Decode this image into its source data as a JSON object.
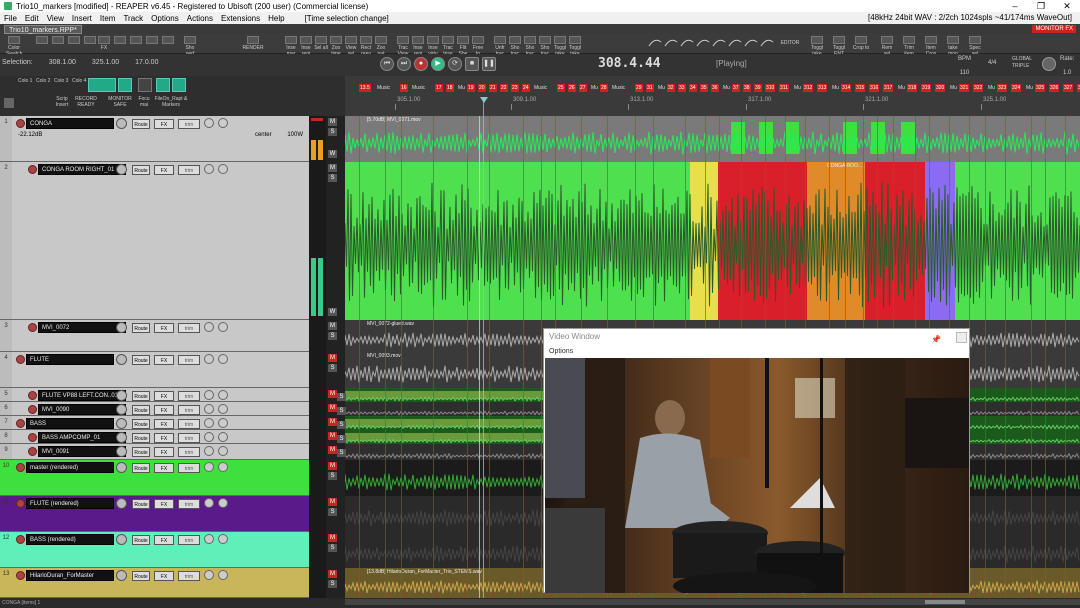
{
  "window": {
    "title": "Trio10_markers [modified] - REAPER v6.45 - Registered to Ubisoft (200 user) (Commercial license)",
    "controls": [
      "–",
      "❐",
      "✕"
    ]
  },
  "menu": {
    "items": [
      "File",
      "Edit",
      "View",
      "Insert",
      "Item",
      "Track",
      "Options",
      "Actions",
      "Extensions",
      "Help"
    ],
    "selection_status": "[Time selection change]",
    "audio_info": "[48kHz 24bit WAV : 2/2ch 1024spls ~41/174ms WaveOut]"
  },
  "project_tab": {
    "label": "Trio10_markers.RPP*",
    "monitor_fx": "MONITOR FX"
  },
  "toolbar": {
    "left": [
      {
        "label": "Color Swatch",
        "icon": "palette-icon"
      },
      {
        "label": "",
        "icon": "grid-icon"
      },
      {
        "label": "",
        "icon": "save-icon"
      },
      {
        "label": "",
        "icon": "disk-icon"
      },
      {
        "label": "",
        "icon": "mixer-icon"
      },
      {
        "label": "FX",
        "icon": "fx-icon"
      },
      {
        "label": "",
        "icon": "window-icon"
      },
      {
        "label": "",
        "icon": "sliders-icon"
      },
      {
        "label": "",
        "icon": "meter-icon"
      },
      {
        "label": "",
        "icon": "keys-icon"
      },
      {
        "label": "Sho perf",
        "icon": "perf-icon"
      },
      {
        "label": "RENDER",
        "icon": "render-icon"
      }
    ],
    "right": [
      "Inse mar",
      "Inse regi",
      "Sel all",
      "Zoo time",
      "View sel",
      "Rect prev",
      "Zoo nat",
      "Trac View",
      "Inse regi",
      "Inse virtu",
      "Trac Inse",
      "Flit She",
      "Free to",
      "Unfr trac",
      "Sho trac",
      "Sho trac",
      "Sho trac",
      "Toggl take",
      "Toggl take"
    ],
    "env_icons": [
      "line-icon",
      "curve-icon",
      "curve2-icon",
      "step-icon",
      "step2-icon",
      "bezier-icon",
      "bezier2-icon",
      "bezier3-icon"
    ],
    "editor": "EDITOR",
    "right2": [
      "Toggl take",
      "Toggl ENT",
      "Crop to",
      "Rem sel",
      "Trim item",
      "Item Cros",
      "take mon",
      "Spec sel"
    ]
  },
  "transport": {
    "selection_label": "Selection:",
    "sel_start": "308.1.00",
    "sel_end": "325.1.00",
    "sel_len": "17.0.00",
    "time": "308.4.44",
    "state": "[Playing]",
    "bpm_label": "BPM",
    "bpm": "110",
    "time_sig": "4/4",
    "sync_label": "GLOBAL",
    "sync_mode": "TRIPLE",
    "rate_label": "Rate:",
    "rate": "1.0"
  },
  "mixer_toolbar": {
    "row1": [
      "Colo 1",
      "Colo 2",
      "Colo 3",
      "Colo 4"
    ],
    "row2": [
      "Scrip Insert",
      "RECORD READY",
      "MONITOR SAFE",
      "Focu mai",
      "FileOn_Rapt & Markers"
    ]
  },
  "ruler": {
    "markers": [
      "13.5",
      "Music",
      "16",
      "Music",
      "17",
      "18",
      "Mu",
      "19",
      "20",
      "21",
      "22",
      "23",
      "24",
      "Music",
      "25",
      "26",
      "27",
      "Mu",
      "28",
      "Music",
      "29",
      "31",
      "Mu",
      "32",
      "33",
      "34",
      "35",
      "36",
      "Mu",
      "37",
      "38",
      "39",
      "310",
      "311",
      "Mu",
      "312",
      "313",
      "Mu",
      "314",
      "315",
      "316",
      "317",
      "Mu",
      "318",
      "319",
      "320",
      "Mu",
      "321",
      "322",
      "Mu",
      "323",
      "324",
      "Mu",
      "325",
      "326",
      "327",
      "328",
      "329"
    ],
    "ticks": [
      "305.1.00",
      "309.1.00",
      "313.1.00",
      "317.1.00",
      "321.1.00",
      "325.1.00"
    ]
  },
  "tracks": [
    {
      "num": "1",
      "name": "CONGA",
      "vol": "-22.12dB",
      "pan": "center",
      "width": "100W",
      "route": "Route",
      "fx": "FX",
      "trim": "trim",
      "item": "[5.70dB] MVI_0071.mov"
    },
    {
      "num": "2",
      "name": "CONGA ROOM RIGHT_01",
      "route": "Route",
      "fx": "FX",
      "trim": "trim",
      "item": "CONGA ROO..."
    },
    {
      "num": "3",
      "name": "MVI_0072",
      "route": "Route",
      "fx": "FX",
      "trim": "trim",
      "item": "MVI_0072-glued.wav"
    },
    {
      "num": "4",
      "name": "FLUTE",
      "route": "Route",
      "fx": "FX",
      "trim": "trim",
      "item": "MVI_0093.mov"
    },
    {
      "num": "5",
      "name": "FLUTE VP88 LEFT.CON..01",
      "route": "Route",
      "fx": "FX",
      "trim": "trim"
    },
    {
      "num": "6",
      "name": "MVI_0090",
      "route": "Route",
      "fx": "FX",
      "trim": "trim"
    },
    {
      "num": "7",
      "name": "BASS",
      "route": "Route",
      "fx": "FX",
      "trim": "trim"
    },
    {
      "num": "8",
      "name": "BASS AMPCOMP_01",
      "route": "Route",
      "fx": "FX",
      "trim": "trim"
    },
    {
      "num": "9",
      "name": "MVI_0091",
      "route": "Route",
      "fx": "FX",
      "trim": "trim"
    },
    {
      "num": "10",
      "name": "master (rendered)",
      "route": "Route",
      "fx": "FX",
      "trim": "trim"
    },
    {
      "num": "11",
      "name": "FLUTE (rendered)",
      "route": "Route",
      "fx": "FX",
      "trim": "trim"
    },
    {
      "num": "12",
      "name": "BASS (rendered)",
      "route": "Route",
      "fx": "FX",
      "trim": "trim"
    },
    {
      "num": "13",
      "name": "HilarioDuran_ForMaster",
      "route": "Route",
      "fx": "FX",
      "trim": "trim",
      "item": "[13.8dB] HilarioDuran_ForMaster_Trio_STEMS.wav"
    }
  ],
  "ms": {
    "m": "M",
    "s": "S",
    "w": "W"
  },
  "video_window": {
    "title": "Video Window",
    "options": "Options",
    "pin_icon": "pin-icon",
    "close_icon": "close-icon"
  },
  "status": {
    "text": "CONGA [items] 1"
  },
  "colors": {
    "green": "#4fe04f",
    "yellow": "#e8e04a",
    "red": "#d81f2a",
    "orange": "#e08a2a",
    "violet": "#8a6cf0",
    "teal": "#5ef0b8",
    "purple": "#5a1a8a",
    "khaki": "#c9b65a",
    "brightgreen": "#3ee03e"
  }
}
